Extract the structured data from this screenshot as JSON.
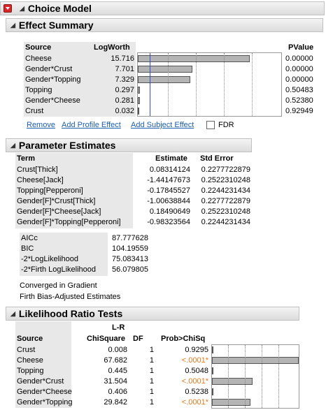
{
  "report": {
    "title": "Choice Model"
  },
  "effect_summary": {
    "title": "Effect Summary",
    "headers": {
      "source": "Source",
      "logworth": "LogWorth",
      "pvalue": "PValue"
    },
    "rows": [
      {
        "source": "Cheese",
        "logworth": "15.716",
        "pvalue": "0.00000",
        "bar": 15.716
      },
      {
        "source": "Gender*Crust",
        "logworth": "7.701",
        "pvalue": "0.00000",
        "bar": 7.701
      },
      {
        "source": "Gender*Topping",
        "logworth": "7.329",
        "pvalue": "0.00000",
        "bar": 7.329
      },
      {
        "source": "Topping",
        "logworth": "0.297",
        "pvalue": "0.50483",
        "bar": 0.297
      },
      {
        "source": "Gender*Cheese",
        "logworth": "0.281",
        "pvalue": "0.52380",
        "bar": 0.281
      },
      {
        "source": "Crust",
        "logworth": "0.032",
        "pvalue": "0.92949",
        "bar": 0.032
      }
    ],
    "actions": {
      "remove": "Remove",
      "add_profile": "Add Profile Effect",
      "add_subject": "Add Subject Effect",
      "fdr": "FDR"
    }
  },
  "parameter_estimates": {
    "title": "Parameter Estimates",
    "headers": {
      "term": "Term",
      "estimate": "Estimate",
      "stderr": "Std Error"
    },
    "rows": [
      {
        "term": "Crust[Thick]",
        "estimate": "0.08314124",
        "stderr": "0.2277722879"
      },
      {
        "term": "Cheese[Jack]",
        "estimate": "-1.44147673",
        "stderr": "0.2522310248"
      },
      {
        "term": "Topping[Pepperoni]",
        "estimate": "-0.17845527",
        "stderr": "0.2244231434"
      },
      {
        "term": "Gender[F]*Crust[Thick]",
        "estimate": "-1.00638844",
        "stderr": "0.2277722879"
      },
      {
        "term": "Gender[F]*Cheese[Jack]",
        "estimate": "0.18490649",
        "stderr": "0.2522310248"
      },
      {
        "term": "Gender[F]*Topping[Pepperoni]",
        "estimate": "-0.98323564",
        "stderr": "0.2244231434"
      }
    ],
    "stats": [
      {
        "label": "AICc",
        "value": "87.777628"
      },
      {
        "label": "BIC",
        "value": "104.19559"
      },
      {
        "label": "-2*LogLikelihood",
        "value": "75.083413"
      },
      {
        "label": "-2*Firth LogLikelihood",
        "value": "56.079805"
      }
    ],
    "notes": [
      "Converged in Gradient",
      "Firth Bias-Adjusted Estimates"
    ]
  },
  "likelihood_ratio": {
    "title": "Likelihood Ratio Tests",
    "headers": {
      "source": "Source",
      "lr_top": "L-R",
      "chisq": "ChiSquare",
      "df": "DF",
      "prob": "Prob>ChiSq"
    },
    "rows": [
      {
        "source": "Crust",
        "chisq": "0.008",
        "df": "1",
        "prob": "0.9295",
        "sig": false,
        "bar": 0.008
      },
      {
        "source": "Cheese",
        "chisq": "67.682",
        "df": "1",
        "prob": "<.0001*",
        "sig": true,
        "bar": 67.682
      },
      {
        "source": "Topping",
        "chisq": "0.445",
        "df": "1",
        "prob": "0.5048",
        "sig": false,
        "bar": 0.445
      },
      {
        "source": "Gender*Crust",
        "chisq": "31.504",
        "df": "1",
        "prob": "<.0001*",
        "sig": true,
        "bar": 31.504
      },
      {
        "source": "Gender*Cheese",
        "chisq": "0.406",
        "df": "1",
        "prob": "0.5238",
        "sig": false,
        "bar": 0.406
      },
      {
        "source": "Gender*Topping",
        "chisq": "29.842",
        "df": "1",
        "prob": "<.0001*",
        "sig": true,
        "bar": 29.842
      }
    ]
  },
  "colors": {
    "sig": "#e07a1f",
    "link": "#1b5eab",
    "refline": "#2f4fd0",
    "menu": "#d8262b"
  }
}
